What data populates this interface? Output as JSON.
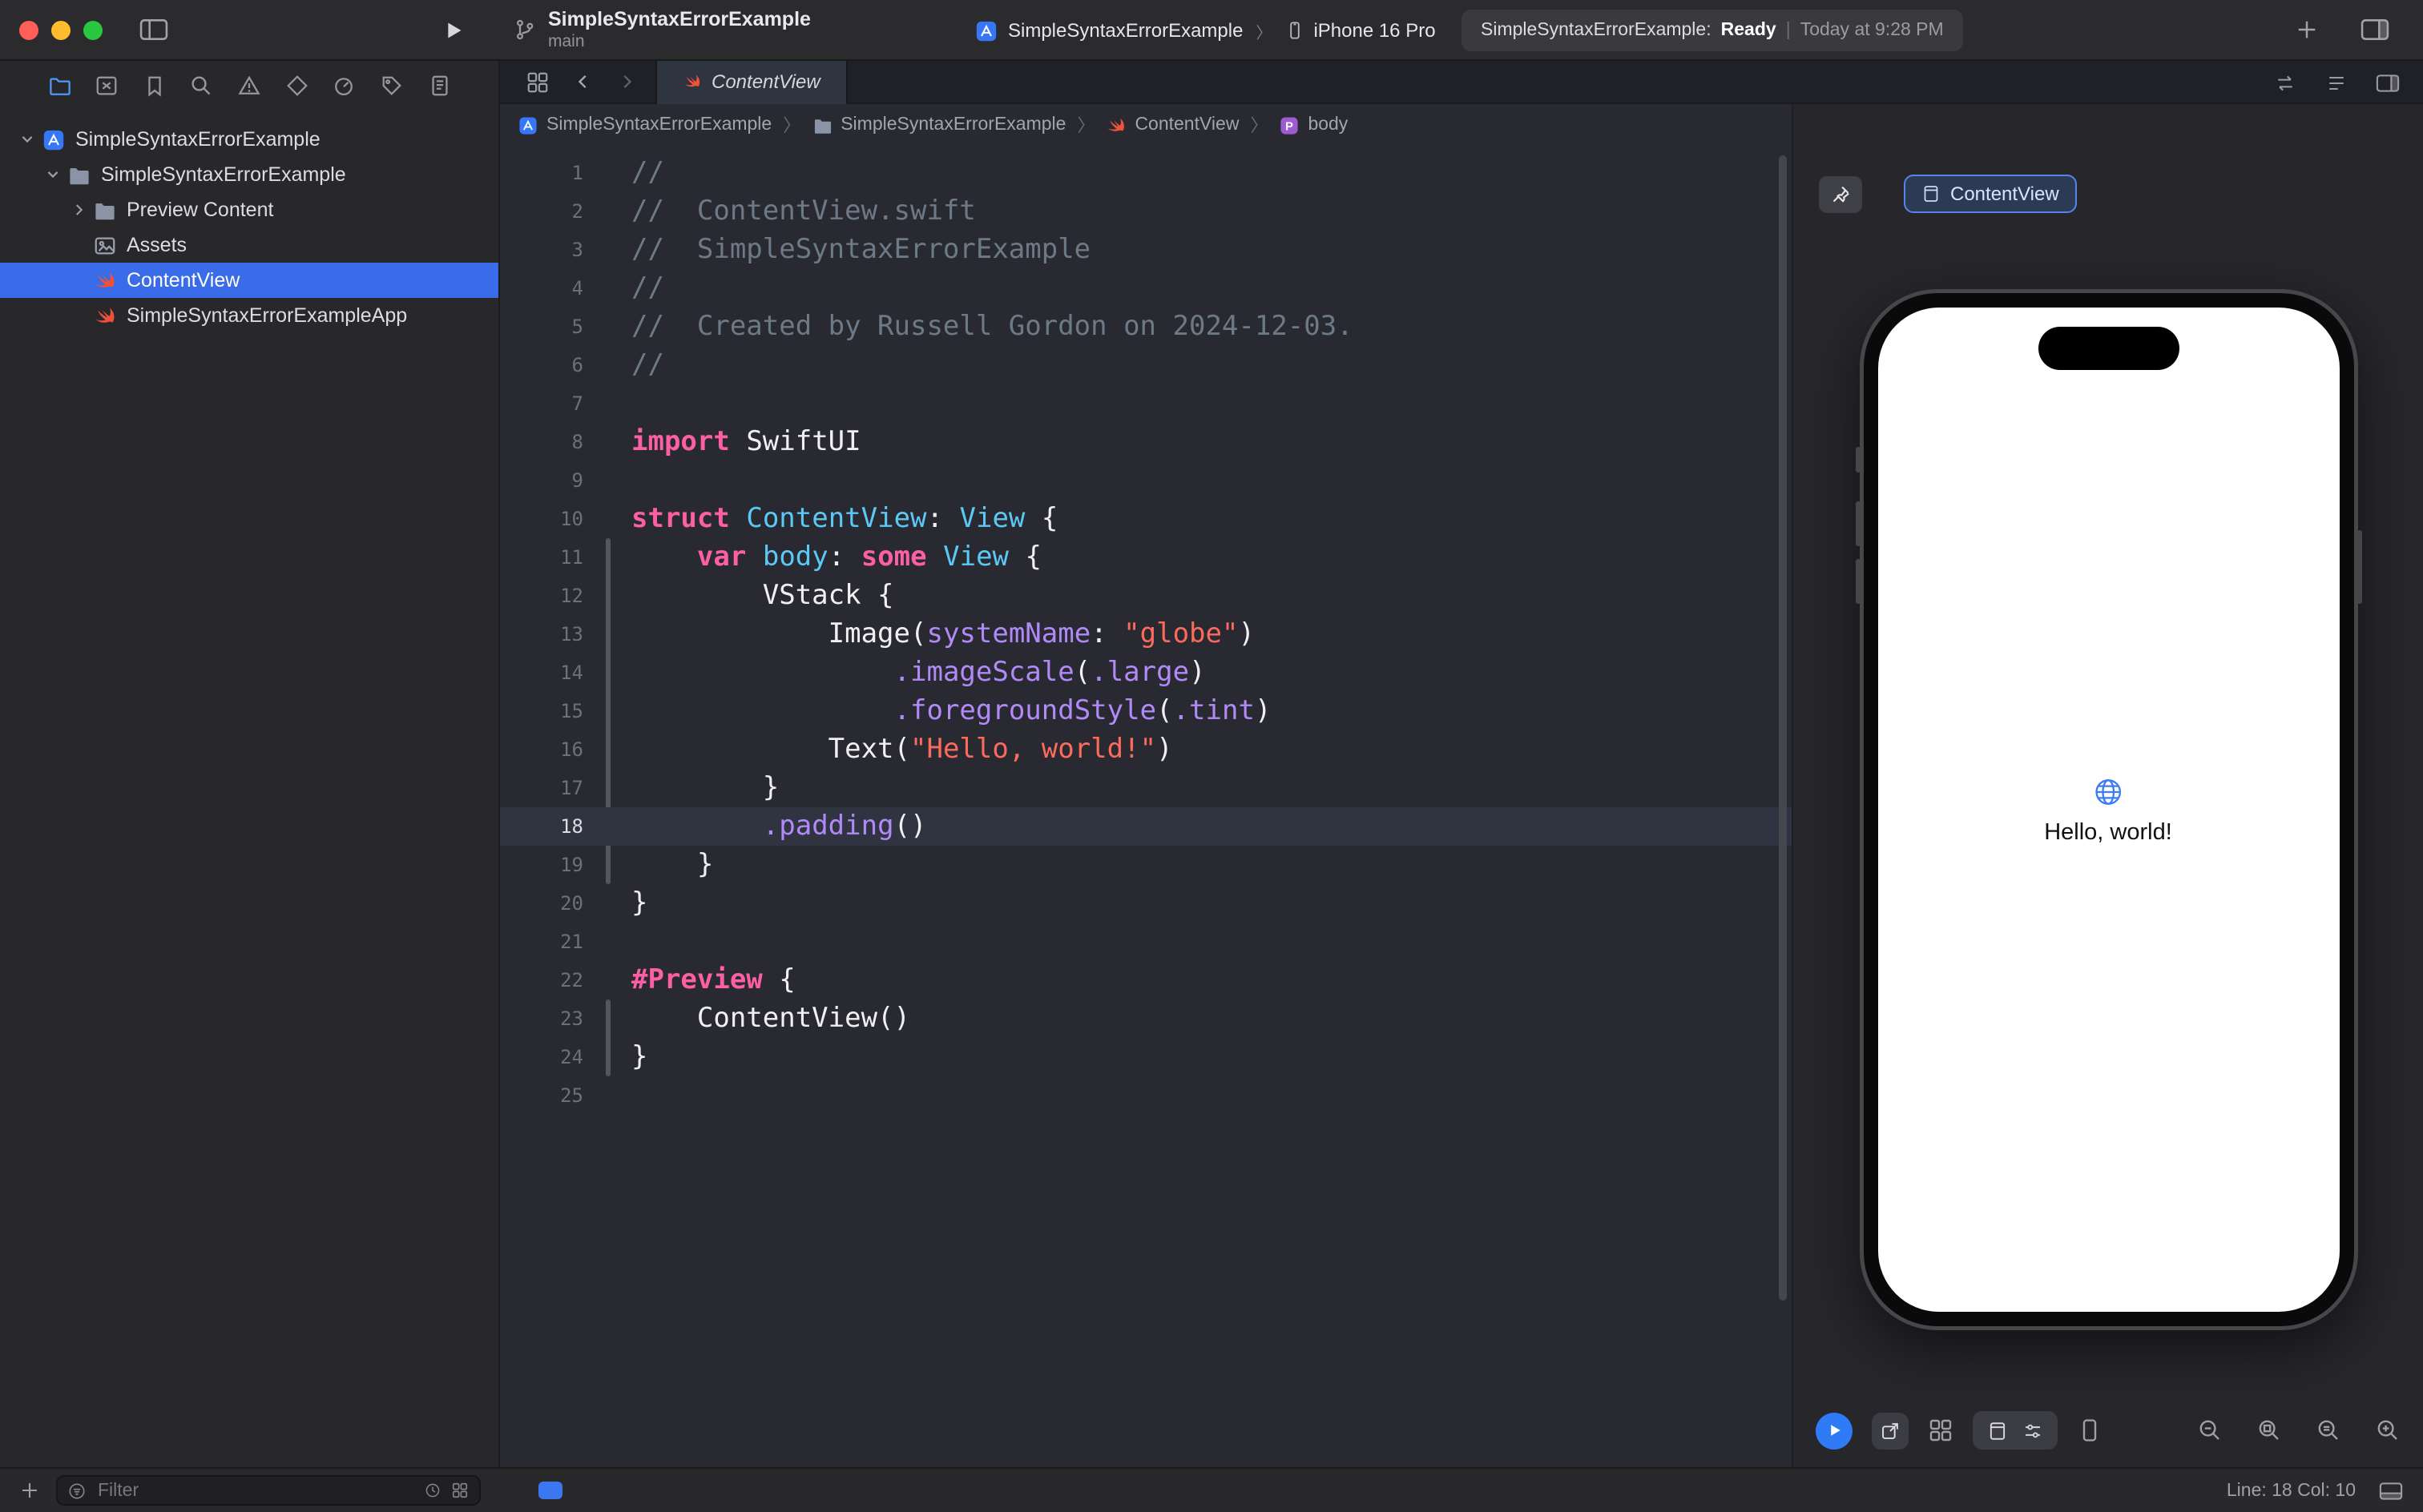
{
  "colors": {
    "accent_blue": "#3A6BE8",
    "swift_orange": "#F05138",
    "selection_blue": "#3A6BE8",
    "preview_play_blue": "#2F7BF5",
    "syntax": {
      "keyword": "#FC5FA3",
      "string": "#FC6A5D",
      "comment": "#6C7986",
      "type": "#5CC8F5",
      "member": "#B18AF8",
      "plain": "#F0F0F2"
    }
  },
  "toolbar": {
    "title": "SimpleSyntaxErrorExample",
    "subtitle": "main",
    "scheme_app": "SimpleSyntaxErrorExample",
    "scheme_device": "iPhone 16 Pro",
    "status_app": "SimpleSyntaxErrorExample:",
    "status_state": "Ready",
    "status_divider": "|",
    "status_time": "Today at 9:28 PM"
  },
  "sidebar": {
    "nav_icons": [
      {
        "id": "project-navigator",
        "icon": "folder"
      },
      {
        "id": "source-control",
        "icon": "square-x"
      },
      {
        "id": "bookmarks",
        "icon": "bookmark"
      },
      {
        "id": "find",
        "icon": "magnifier"
      },
      {
        "id": "issues",
        "icon": "warning"
      },
      {
        "id": "tests",
        "icon": "diamond"
      },
      {
        "id": "debug",
        "icon": "gauge"
      },
      {
        "id": "breakpoints",
        "icon": "tag"
      },
      {
        "id": "reports",
        "icon": "report"
      }
    ],
    "tree": [
      {
        "id": "project-root",
        "label": "SimpleSyntaxErrorExample",
        "icon": "project",
        "level": 0,
        "disc": "open"
      },
      {
        "id": "group-simplesyntaxerrorexample",
        "label": "SimpleSyntaxErrorExample",
        "icon": "folder-solid",
        "level": 1,
        "disc": "open"
      },
      {
        "id": "preview-content",
        "label": "Preview Content",
        "icon": "folder-solid",
        "level": 2,
        "disc": "closed"
      },
      {
        "id": "assets",
        "label": "Assets",
        "icon": "assets",
        "level": 2
      },
      {
        "id": "contentview",
        "label": "ContentView",
        "icon": "swift",
        "level": 2,
        "selected": true
      },
      {
        "id": "app-file",
        "label": "SimpleSyntaxErrorExampleApp",
        "icon": "swift",
        "level": 2
      }
    ],
    "filter": {
      "placeholder": "Filter"
    }
  },
  "editor": {
    "tab_label": "ContentView",
    "breadcrumbs": [
      {
        "label": "SimpleSyntaxErrorExample",
        "icon": "project"
      },
      {
        "label": "SimpleSyntaxErrorExample",
        "icon": "folder-solid"
      },
      {
        "label": "ContentView",
        "icon": "swift"
      },
      {
        "label": "body",
        "icon": "p-badge"
      }
    ],
    "current_line": 18,
    "lines": [
      {
        "n": 1,
        "s": [
          [
            "cmt",
            "//"
          ]
        ]
      },
      {
        "n": 2,
        "s": [
          [
            "cmt",
            "//  ContentView.swift"
          ]
        ]
      },
      {
        "n": 3,
        "s": [
          [
            "cmt",
            "//  SimpleSyntaxErrorExample"
          ]
        ]
      },
      {
        "n": 4,
        "s": [
          [
            "cmt",
            "//"
          ]
        ]
      },
      {
        "n": 5,
        "s": [
          [
            "cmt",
            "//  Created by Russell Gordon on 2024-12-03."
          ]
        ]
      },
      {
        "n": 6,
        "s": [
          [
            "cmt",
            "//"
          ]
        ]
      },
      {
        "n": 7,
        "s": []
      },
      {
        "n": 8,
        "s": [
          [
            "kw",
            "import"
          ],
          [
            "pln",
            " SwiftUI"
          ]
        ]
      },
      {
        "n": 9,
        "s": []
      },
      {
        "n": 10,
        "s": [
          [
            "kw",
            "struct"
          ],
          [
            "pln",
            " "
          ],
          [
            "type",
            "ContentView"
          ],
          [
            "pln",
            ": "
          ],
          [
            "type",
            "View"
          ],
          [
            "pln",
            " {"
          ]
        ]
      },
      {
        "n": 11,
        "s": [
          [
            "pln",
            "    "
          ],
          [
            "kw",
            "var"
          ],
          [
            "pln",
            " "
          ],
          [
            "type",
            "body"
          ],
          [
            "pln",
            ": "
          ],
          [
            "kw",
            "some"
          ],
          [
            "pln",
            " "
          ],
          [
            "type",
            "View"
          ],
          [
            "pln",
            " {"
          ]
        ]
      },
      {
        "n": 12,
        "s": [
          [
            "pln",
            "        VStack {"
          ]
        ]
      },
      {
        "n": 13,
        "s": [
          [
            "pln",
            "            Image("
          ],
          [
            "prm",
            "systemName"
          ],
          [
            "pln",
            ": "
          ],
          [
            "str",
            "\"globe\""
          ],
          [
            "pln",
            ")"
          ]
        ]
      },
      {
        "n": 14,
        "s": [
          [
            "pln",
            "                "
          ],
          [
            "mem",
            ".imageScale"
          ],
          [
            "pln",
            "("
          ],
          [
            "mem",
            ".large"
          ],
          [
            "pln",
            ")"
          ]
        ]
      },
      {
        "n": 15,
        "s": [
          [
            "pln",
            "                "
          ],
          [
            "mem",
            ".foregroundStyle"
          ],
          [
            "pln",
            "("
          ],
          [
            "mem",
            ".tint"
          ],
          [
            "pln",
            ")"
          ]
        ]
      },
      {
        "n": 16,
        "s": [
          [
            "pln",
            "            Text("
          ],
          [
            "str",
            "\"Hello, world!\""
          ],
          [
            "pln",
            ")"
          ]
        ]
      },
      {
        "n": 17,
        "s": [
          [
            "pln",
            "        }"
          ]
        ]
      },
      {
        "n": 18,
        "s": [
          [
            "pln",
            "        "
          ],
          [
            "mem",
            ".padding"
          ],
          [
            "pln",
            "()"
          ]
        ]
      },
      {
        "n": 19,
        "s": [
          [
            "pln",
            "    }"
          ]
        ]
      },
      {
        "n": 20,
        "s": [
          [
            "pln",
            "}"
          ]
        ]
      },
      {
        "n": 21,
        "s": []
      },
      {
        "n": 22,
        "s": [
          [
            "kw",
            "#Preview"
          ],
          [
            "pln",
            " {"
          ]
        ]
      },
      {
        "n": 23,
        "s": [
          [
            "pln",
            "    ContentView()"
          ]
        ]
      },
      {
        "n": 24,
        "s": [
          [
            "pln",
            "}"
          ]
        ]
      },
      {
        "n": 25,
        "s": []
      }
    ]
  },
  "canvas": {
    "tab_label": "ContentView",
    "greeting": "Hello, world!"
  },
  "statusbar": {
    "line_col": "Line: 18 Col: 10"
  }
}
